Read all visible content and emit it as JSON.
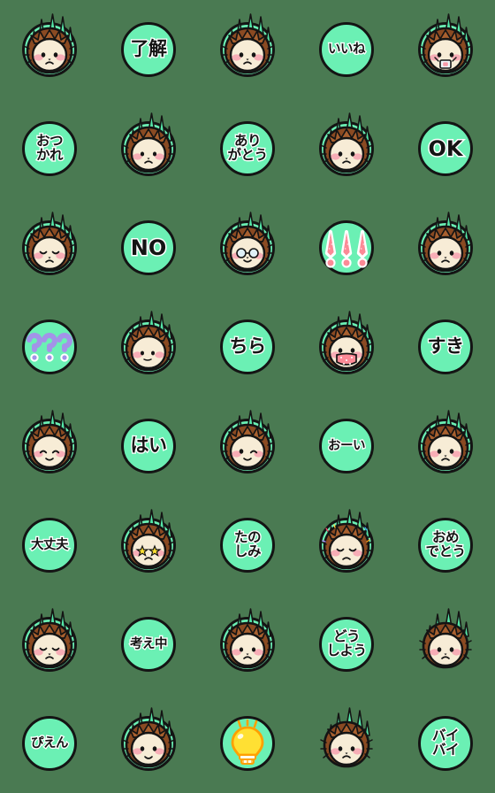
{
  "sheet": {
    "title": "Hedgehog Emoji Sticker Sheet",
    "columns": 5,
    "rows": 8,
    "background_color": "#4a7a52",
    "badge_color": "#6bf0b4",
    "text_color": "#141414",
    "text_outline_color": "#ffffff",
    "hair_color": "#8a4a22",
    "hair_highlight": "#a8602f",
    "face_color": "#f7ecd6",
    "cheek_color": "#f7aab4",
    "spike_green": "#55e8a8",
    "accent_purple": "#a393e8",
    "accent_pink": "#fc8a96",
    "accent_yellow": "#ffe033",
    "accent_orange": "#ffa000"
  },
  "cells": [
    {
      "index": 1,
      "row": 1,
      "col": 1,
      "type": "face",
      "name": "hedgehog-neutral",
      "disc": true,
      "text": ""
    },
    {
      "index": 2,
      "row": 1,
      "col": 2,
      "type": "text",
      "name": "badge-ryoukai",
      "disc": true,
      "text": "了解",
      "lines": 1,
      "style": "one"
    },
    {
      "index": 3,
      "row": 1,
      "col": 3,
      "type": "face",
      "name": "hedgehog-sweat",
      "disc": true,
      "text": ""
    },
    {
      "index": 4,
      "row": 1,
      "col": 4,
      "type": "text",
      "name": "badge-iine",
      "disc": true,
      "text": "いいね",
      "lines": 1,
      "style": "sm"
    },
    {
      "index": 5,
      "row": 1,
      "col": 5,
      "type": "face",
      "name": "hedgehog-drinking-cup",
      "disc": true,
      "text": ""
    },
    {
      "index": 6,
      "row": 2,
      "col": 1,
      "type": "text",
      "name": "badge-otsukare",
      "disc": true,
      "text": "おつ\nかれ",
      "lines": 2,
      "style": "two"
    },
    {
      "index": 7,
      "row": 2,
      "col": 2,
      "type": "face",
      "name": "hedgehog-worried",
      "disc": true,
      "text": ""
    },
    {
      "index": 8,
      "row": 2,
      "col": 3,
      "type": "text",
      "name": "badge-arigatou",
      "disc": true,
      "text": "あり\nがとう",
      "lines": 2,
      "style": "two"
    },
    {
      "index": 9,
      "row": 2,
      "col": 4,
      "type": "face",
      "name": "hedgehog-flat-mouth",
      "disc": true,
      "text": ""
    },
    {
      "index": 10,
      "row": 2,
      "col": 5,
      "type": "text",
      "name": "badge-ok",
      "disc": true,
      "text": "OK",
      "lines": 1,
      "style": "lat"
    },
    {
      "index": 11,
      "row": 3,
      "col": 1,
      "type": "face",
      "name": "hedgehog-squinting",
      "disc": true,
      "text": ""
    },
    {
      "index": 12,
      "row": 3,
      "col": 2,
      "type": "text",
      "name": "badge-no",
      "disc": true,
      "text": "NO",
      "lines": 1,
      "style": "lat"
    },
    {
      "index": 13,
      "row": 3,
      "col": 3,
      "type": "face",
      "name": "hedgehog-glasses",
      "disc": true,
      "text": ""
    },
    {
      "index": 14,
      "row": 3,
      "col": 4,
      "type": "sym",
      "name": "exclamation-marks-icon",
      "disc": true,
      "text": "!!!"
    },
    {
      "index": 15,
      "row": 3,
      "col": 5,
      "type": "face",
      "name": "hedgehog-neutral-2",
      "disc": true,
      "text": ""
    },
    {
      "index": 16,
      "row": 4,
      "col": 1,
      "type": "sym",
      "name": "question-marks-icon",
      "disc": true,
      "text": "???"
    },
    {
      "index": 17,
      "row": 4,
      "col": 2,
      "type": "face",
      "name": "hedgehog-peeking",
      "disc": true,
      "text": ""
    },
    {
      "index": 18,
      "row": 4,
      "col": 3,
      "type": "text",
      "name": "badge-chira",
      "disc": true,
      "text": "ちら",
      "lines": 1,
      "style": "one"
    },
    {
      "index": 19,
      "row": 4,
      "col": 4,
      "type": "face",
      "name": "hedgehog-pink-mask",
      "disc": true,
      "text": ""
    },
    {
      "index": 20,
      "row": 4,
      "col": 5,
      "type": "text",
      "name": "badge-suki",
      "disc": true,
      "text": "すき",
      "lines": 1,
      "style": "one"
    },
    {
      "index": 21,
      "row": 5,
      "col": 1,
      "type": "face",
      "name": "hedgehog-closed-eyes",
      "disc": true,
      "text": ""
    },
    {
      "index": 22,
      "row": 5,
      "col": 2,
      "type": "text",
      "name": "badge-hai",
      "disc": true,
      "text": "はい",
      "lines": 1,
      "style": "one"
    },
    {
      "index": 23,
      "row": 5,
      "col": 3,
      "type": "face",
      "name": "hedgehog-winking",
      "disc": true,
      "text": ""
    },
    {
      "index": 24,
      "row": 5,
      "col": 4,
      "type": "text",
      "name": "badge-ooi",
      "disc": true,
      "text": "おーい",
      "lines": 1,
      "style": "sm"
    },
    {
      "index": 25,
      "row": 5,
      "col": 5,
      "type": "face",
      "name": "hedgehog-shy",
      "disc": true,
      "text": ""
    },
    {
      "index": 26,
      "row": 6,
      "col": 1,
      "type": "text",
      "name": "badge-daijoubu",
      "disc": true,
      "text": "大丈夫",
      "lines": 1,
      "style": "sm"
    },
    {
      "index": 27,
      "row": 6,
      "col": 2,
      "type": "face",
      "name": "hedgehog-star-eyes",
      "disc": true,
      "text": ""
    },
    {
      "index": 28,
      "row": 6,
      "col": 3,
      "type": "text",
      "name": "badge-tanoshimi",
      "disc": true,
      "text": "たの\nしみ",
      "lines": 2,
      "style": "two"
    },
    {
      "index": 29,
      "row": 6,
      "col": 4,
      "type": "face",
      "name": "hedgehog-confetti",
      "disc": true,
      "text": ""
    },
    {
      "index": 30,
      "row": 6,
      "col": 5,
      "type": "text",
      "name": "badge-omedetou",
      "disc": true,
      "text": "おめ\nでとう",
      "lines": 2,
      "style": "two"
    },
    {
      "index": 31,
      "row": 7,
      "col": 1,
      "type": "face",
      "name": "hedgehog-frowning",
      "disc": true,
      "text": ""
    },
    {
      "index": 32,
      "row": 7,
      "col": 2,
      "type": "text",
      "name": "badge-kangaechuu",
      "disc": true,
      "text": "考え中",
      "lines": 1,
      "style": "sm"
    },
    {
      "index": 33,
      "row": 7,
      "col": 3,
      "type": "face",
      "name": "hedgehog-sad",
      "disc": true,
      "text": ""
    },
    {
      "index": 34,
      "row": 7,
      "col": 4,
      "type": "text",
      "name": "badge-doushiyou",
      "disc": true,
      "text": "どう\nしよう",
      "lines": 2,
      "style": "two"
    },
    {
      "index": 35,
      "row": 7,
      "col": 5,
      "type": "face",
      "name": "hedgehog-plain-pout",
      "disc": false,
      "text": ""
    },
    {
      "index": 36,
      "row": 8,
      "col": 1,
      "type": "text",
      "name": "badge-pien",
      "disc": true,
      "text": "ぴえん",
      "lines": 1,
      "style": "sm"
    },
    {
      "index": 37,
      "row": 8,
      "col": 2,
      "type": "face",
      "name": "hedgehog-crown",
      "disc": true,
      "text": ""
    },
    {
      "index": 38,
      "row": 8,
      "col": 3,
      "type": "sym",
      "name": "lightbulb-icon",
      "disc": true,
      "text": ""
    },
    {
      "index": 39,
      "row": 8,
      "col": 4,
      "type": "face",
      "name": "hedgehog-plain-side",
      "disc": false,
      "text": ""
    },
    {
      "index": 40,
      "row": 8,
      "col": 5,
      "type": "text",
      "name": "badge-baibai",
      "disc": true,
      "text": "バイ\nバイ",
      "lines": 2,
      "style": "two"
    }
  ]
}
